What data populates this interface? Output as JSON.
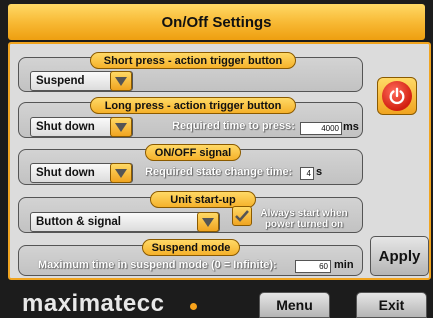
{
  "title": "On/Off Settings",
  "short_press": {
    "tag": "Short press - action trigger button",
    "value": "Suspend"
  },
  "long_press": {
    "tag": "Long press - action trigger button",
    "value": "Shut down",
    "time_label": "Required time to press:",
    "time_value": "4000",
    "time_unit": "ms"
  },
  "onoff_signal": {
    "tag": "ON/OFF signal",
    "value": "Shut down",
    "time_label": "Required state change time:",
    "time_value": "4",
    "time_unit": "s"
  },
  "unit_startup": {
    "tag": "Unit start-up",
    "value": "Button & signal",
    "checkbox_label": "Always start when power turned on",
    "checkbox_checked": true
  },
  "suspend_mode": {
    "tag": "Suspend mode",
    "max_label": "Maximum time in suspend mode (0 = Infinite):",
    "max_value": "60",
    "max_unit": "min"
  },
  "buttons": {
    "apply": "Apply",
    "menu": "Menu",
    "exit": "Exit"
  },
  "logo_text": "maximatecc",
  "icons": {
    "power": "power-icon",
    "dropdown": "chevron-down-icon",
    "check": "check-icon"
  },
  "colors": {
    "accent": "#f7b731",
    "power_red": "#d21f10",
    "background": "#1c1c1c"
  }
}
